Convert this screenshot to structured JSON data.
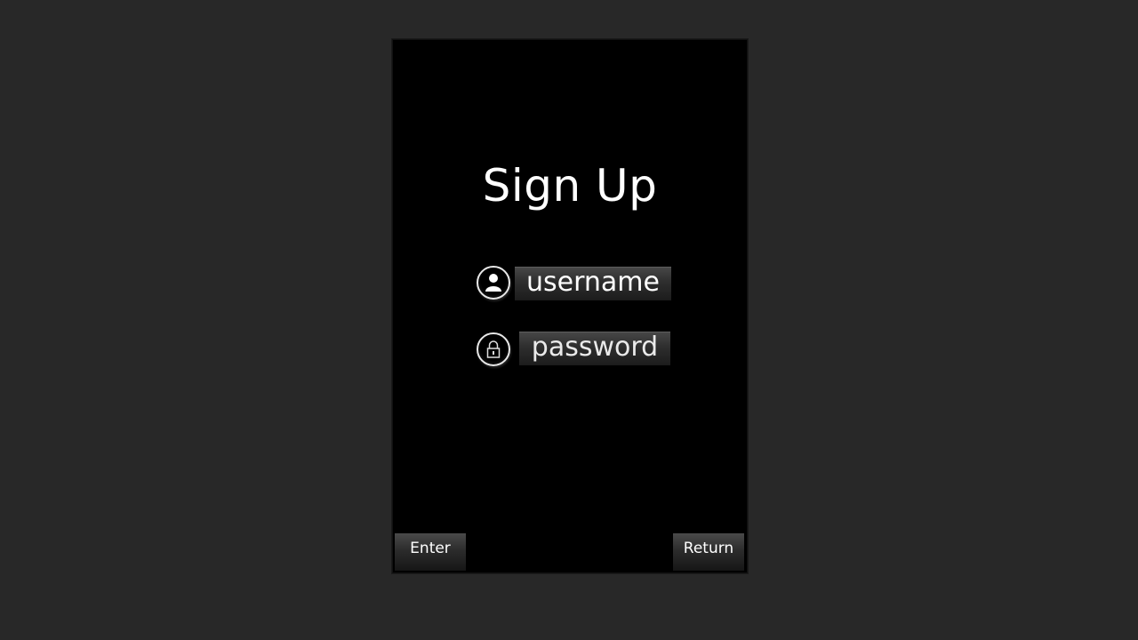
{
  "form": {
    "title": "Sign Up",
    "username_field": {
      "value": "username",
      "icon": "user-icon"
    },
    "password_field": {
      "value": "password",
      "icon": "lock-icon"
    }
  },
  "buttons": {
    "enter_label": "Enter",
    "return_label": "Return"
  },
  "colors": {
    "background": "#282828",
    "panel": "#000000",
    "text": "#ffffff"
  }
}
